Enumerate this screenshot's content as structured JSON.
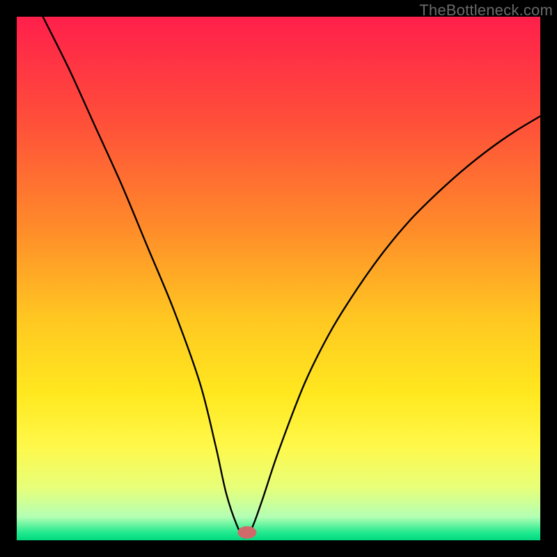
{
  "watermark": "TheBottleneck.com",
  "chart_data": {
    "type": "line",
    "title": "",
    "xlabel": "",
    "ylabel": "",
    "xlim": [
      0,
      100
    ],
    "ylim": [
      0,
      100
    ],
    "grid": false,
    "legend": false,
    "gradient_stops": [
      {
        "offset": 0.0,
        "color": "#ff1f4b"
      },
      {
        "offset": 0.2,
        "color": "#ff4f3a"
      },
      {
        "offset": 0.4,
        "color": "#ff8a2a"
      },
      {
        "offset": 0.58,
        "color": "#ffc821"
      },
      {
        "offset": 0.72,
        "color": "#ffe81f"
      },
      {
        "offset": 0.82,
        "color": "#fff84a"
      },
      {
        "offset": 0.9,
        "color": "#e7ff7a"
      },
      {
        "offset": 0.955,
        "color": "#b4ffb4"
      },
      {
        "offset": 0.985,
        "color": "#22e98f"
      },
      {
        "offset": 1.0,
        "color": "#00d97f"
      }
    ],
    "series": [
      {
        "name": "bottleneck-curve",
        "x": [
          5,
          10,
          15,
          20,
          25,
          30,
          35,
          38,
          40,
          42,
          43.5,
          45,
          47,
          50,
          55,
          60,
          65,
          70,
          75,
          80,
          85,
          90,
          95,
          100
        ],
        "y": [
          100,
          90,
          79,
          68,
          56,
          44,
          30,
          18,
          9,
          3,
          0.5,
          2.5,
          8,
          17,
          30,
          40,
          48,
          55,
          61,
          66,
          70.5,
          74.5,
          78,
          81
        ]
      }
    ],
    "marker": {
      "x": 44,
      "y": 1.5,
      "rx": 1.8,
      "ry": 1.2,
      "color": "#d06a6a"
    }
  }
}
